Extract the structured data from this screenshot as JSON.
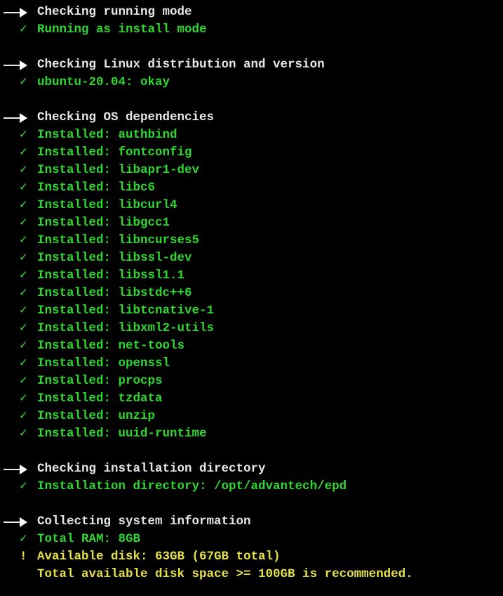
{
  "colors": {
    "background": "#000000",
    "heading": "#e6e6e6",
    "success": "#2fd62f",
    "warning": "#e4e04a"
  },
  "icons": {
    "heading": "arrow-right-icon",
    "success": "check-icon",
    "warning": "exclamation-icon"
  },
  "sections": [
    {
      "heading": "Checking running mode",
      "lines": [
        {
          "status": "ok",
          "mark": "✓",
          "text": "Running as install mode"
        }
      ]
    },
    {
      "heading": "Checking Linux distribution and version",
      "lines": [
        {
          "status": "ok",
          "mark": "✓",
          "text": "ubuntu-20.04: okay"
        }
      ]
    },
    {
      "heading": "Checking OS dependencies",
      "lines": [
        {
          "status": "ok",
          "mark": "✓",
          "text": "Installed: authbind"
        },
        {
          "status": "ok",
          "mark": "✓",
          "text": "Installed: fontconfig"
        },
        {
          "status": "ok",
          "mark": "✓",
          "text": "Installed: libapr1-dev"
        },
        {
          "status": "ok",
          "mark": "✓",
          "text": "Installed: libc6"
        },
        {
          "status": "ok",
          "mark": "✓",
          "text": "Installed: libcurl4"
        },
        {
          "status": "ok",
          "mark": "✓",
          "text": "Installed: libgcc1"
        },
        {
          "status": "ok",
          "mark": "✓",
          "text": "Installed: libncurses5"
        },
        {
          "status": "ok",
          "mark": "✓",
          "text": "Installed: libssl-dev"
        },
        {
          "status": "ok",
          "mark": "✓",
          "text": "Installed: libssl1.1"
        },
        {
          "status": "ok",
          "mark": "✓",
          "text": "Installed: libstdc++6"
        },
        {
          "status": "ok",
          "mark": "✓",
          "text": "Installed: libtcnative-1"
        },
        {
          "status": "ok",
          "mark": "✓",
          "text": "Installed: libxml2-utils"
        },
        {
          "status": "ok",
          "mark": "✓",
          "text": "Installed: net-tools"
        },
        {
          "status": "ok",
          "mark": "✓",
          "text": "Installed: openssl"
        },
        {
          "status": "ok",
          "mark": "✓",
          "text": "Installed: procps"
        },
        {
          "status": "ok",
          "mark": "✓",
          "text": "Installed: tzdata"
        },
        {
          "status": "ok",
          "mark": "✓",
          "text": "Installed: unzip"
        },
        {
          "status": "ok",
          "mark": "✓",
          "text": "Installed: uuid-runtime"
        }
      ]
    },
    {
      "heading": "Checking installation directory",
      "lines": [
        {
          "status": "ok",
          "mark": "✓",
          "text": "Installation directory: /opt/advantech/epd"
        }
      ]
    },
    {
      "heading": "Collecting system information",
      "lines": [
        {
          "status": "ok",
          "mark": "✓",
          "text": "Total RAM: 8GB"
        },
        {
          "status": "warn",
          "mark": "!",
          "text": "Available disk: 63GB (67GB total)"
        },
        {
          "status": "warn",
          "mark": "",
          "text": "Total available disk space >= 100GB is recommended."
        }
      ]
    }
  ]
}
